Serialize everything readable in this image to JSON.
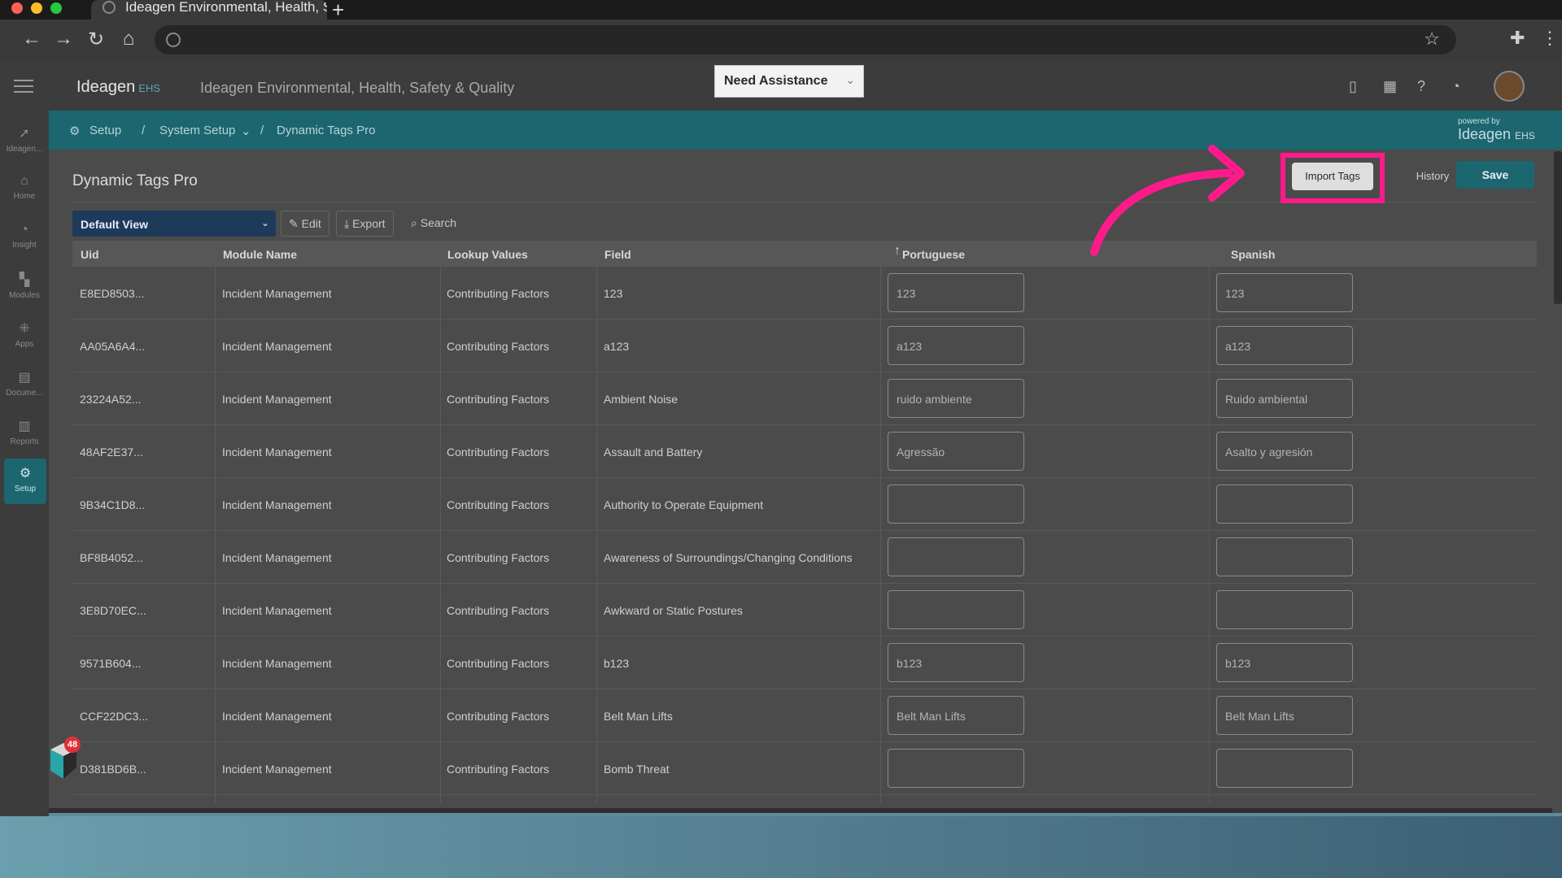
{
  "browser": {
    "tab_title": "Ideagen Environmental, Health, S",
    "new_tab": "+",
    "back": "←",
    "forward": "→",
    "reload": "↻",
    "home": "⌂",
    "bookmark": "☆",
    "extensions": "✚",
    "menu": "⋮"
  },
  "app": {
    "logo": "Ideagen",
    "logo_suffix": "EHS",
    "title": "Ideagen Environmental, Health, Safety & Quality",
    "assistance": "Need Assistance",
    "header_icons": [
      "mobile-icon",
      "calendar-icon",
      "help-icon",
      "bell-icon"
    ]
  },
  "sidebar": {
    "items": [
      {
        "label": "Ideagen...",
        "icon": "ideagen-icon"
      },
      {
        "label": "Home",
        "icon": "home-icon"
      },
      {
        "label": "Insight",
        "icon": "insight-icon"
      },
      {
        "label": "Modules",
        "icon": "modules-icon"
      },
      {
        "label": "Apps",
        "icon": "apps-icon"
      },
      {
        "label": "Docume...",
        "icon": "document-icon"
      },
      {
        "label": "Reports",
        "icon": "reports-icon"
      },
      {
        "label": "Setup",
        "icon": "setup-icon"
      }
    ]
  },
  "breadcrumb": {
    "setup": "Setup",
    "sep1": "/",
    "system_setup": "System Setup",
    "sep2": "/",
    "current": "Dynamic Tags Pro"
  },
  "powered": {
    "small": "powered by",
    "brand": "Ideagen",
    "suffix": "EHS"
  },
  "page": {
    "title": "Dynamic Tags Pro",
    "import_tags": "Import Tags",
    "history": "History",
    "save": "Save",
    "view": "Default View",
    "edit": "Edit",
    "export": "Export",
    "search": "Search"
  },
  "table": {
    "columns": [
      "Uid",
      "Module Name",
      "Lookup Values",
      "Field",
      "Portuguese",
      "Spanish"
    ],
    "rows": [
      {
        "uid": "E8ED8503...",
        "module": "Incident Management",
        "lookup": "Contributing Factors",
        "field": "123",
        "pt": "123",
        "es": "123"
      },
      {
        "uid": "AA05A6A4...",
        "module": "Incident Management",
        "lookup": "Contributing Factors",
        "field": "a123",
        "pt": "a123",
        "es": "a123"
      },
      {
        "uid": "23224A52...",
        "module": "Incident Management",
        "lookup": "Contributing Factors",
        "field": "Ambient Noise",
        "pt": "ruido ambiente",
        "es": "Ruido ambiental"
      },
      {
        "uid": "48AF2E37...",
        "module": "Incident Management",
        "lookup": "Contributing Factors",
        "field": "Assault and Battery",
        "pt": "Agressão",
        "es": "Asalto y agresión"
      },
      {
        "uid": "9B34C1D8...",
        "module": "Incident Management",
        "lookup": "Contributing Factors",
        "field": "Authority to Operate Equipment",
        "pt": "",
        "es": ""
      },
      {
        "uid": "BF8B4052...",
        "module": "Incident Management",
        "lookup": "Contributing Factors",
        "field": "Awareness of Surroundings/Changing Conditions",
        "pt": "",
        "es": ""
      },
      {
        "uid": "3E8D70EC...",
        "module": "Incident Management",
        "lookup": "Contributing Factors",
        "field": "Awkward or Static Postures",
        "pt": "",
        "es": ""
      },
      {
        "uid": "9571B604...",
        "module": "Incident Management",
        "lookup": "Contributing Factors",
        "field": "b123",
        "pt": "b123",
        "es": "b123"
      },
      {
        "uid": "CCF22DC3...",
        "module": "Incident Management",
        "lookup": "Contributing Factors",
        "field": "Belt Man Lifts",
        "pt": "Belt Man Lifts",
        "es": "Belt Man Lifts"
      },
      {
        "uid": "D381BD6B...",
        "module": "Incident Management",
        "lookup": "Contributing Factors",
        "field": "Bomb Threat",
        "pt": "",
        "es": ""
      }
    ]
  },
  "chat_badge": "48",
  "colors": {
    "accent": "#1c6670",
    "highlight": "#ff1a8c",
    "select": "#1e3a5a"
  }
}
